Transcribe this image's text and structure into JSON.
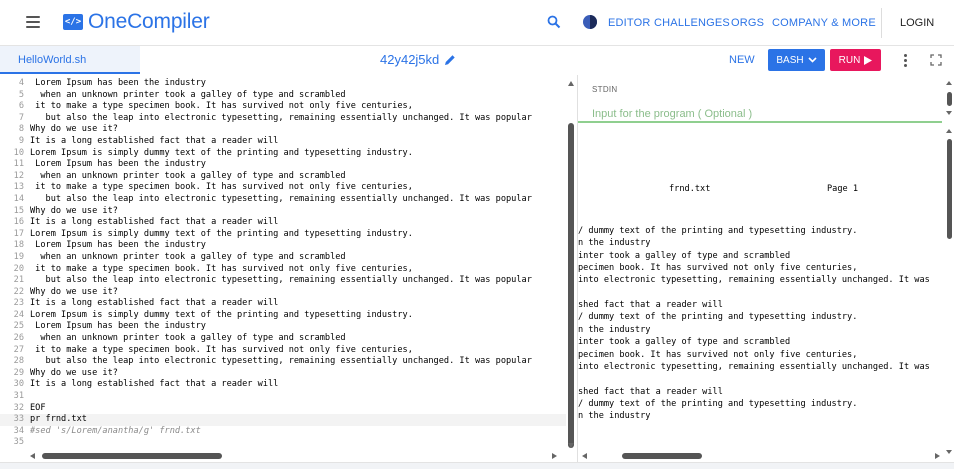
{
  "header": {
    "logo_badge": "</>",
    "logo_text": "OneCompiler",
    "nav": [
      "EDITOR",
      "CHALLENGES",
      "ORGS",
      "COMPANY & MORE"
    ],
    "login": "LOGIN"
  },
  "toolbar": {
    "file_tab": "HelloWorld.sh",
    "code_id": "42y42j5kd",
    "new_label": "NEW",
    "language_label": "BASH",
    "run_label": "RUN"
  },
  "colors": {
    "accent": "#2b73e6",
    "run": "#e8175d",
    "stdin_underline": "#8fcf8f"
  },
  "editor": {
    "lines": [
      {
        "n": "4",
        "t": " Lorem Ipsum has been the industry"
      },
      {
        "n": "5",
        "t": "  when an unknown printer took a galley of type and scrambled"
      },
      {
        "n": "6",
        "t": " it to make a type specimen book. It has survived not only five centuries,"
      },
      {
        "n": "7",
        "t": "   but also the leap into electronic typesetting, remaining essentially unchanged. It was popular"
      },
      {
        "n": "8",
        "t": "Why do we use it?"
      },
      {
        "n": "9",
        "t": "It is a long established fact that a reader will"
      },
      {
        "n": "10",
        "t": "Lorem Ipsum is simply dummy text of the printing and typesetting industry."
      },
      {
        "n": "11",
        "t": " Lorem Ipsum has been the industry"
      },
      {
        "n": "12",
        "t": "  when an unknown printer took a galley of type and scrambled"
      },
      {
        "n": "13",
        "t": " it to make a type specimen book. It has survived not only five centuries,"
      },
      {
        "n": "14",
        "t": "   but also the leap into electronic typesetting, remaining essentially unchanged. It was popular"
      },
      {
        "n": "15",
        "t": "Why do we use it?"
      },
      {
        "n": "16",
        "t": "It is a long established fact that a reader will"
      },
      {
        "n": "17",
        "t": "Lorem Ipsum is simply dummy text of the printing and typesetting industry."
      },
      {
        "n": "18",
        "t": " Lorem Ipsum has been the industry"
      },
      {
        "n": "19",
        "t": "  when an unknown printer took a galley of type and scrambled"
      },
      {
        "n": "20",
        "t": " it to make a type specimen book. It has survived not only five centuries,"
      },
      {
        "n": "21",
        "t": "   but also the leap into electronic typesetting, remaining essentially unchanged. It was popular"
      },
      {
        "n": "22",
        "t": "Why do we use it?"
      },
      {
        "n": "23",
        "t": "It is a long established fact that a reader will"
      },
      {
        "n": "24",
        "t": "Lorem Ipsum is simply dummy text of the printing and typesetting industry."
      },
      {
        "n": "25",
        "t": " Lorem Ipsum has been the industry"
      },
      {
        "n": "26",
        "t": "  when an unknown printer took a galley of type and scrambled"
      },
      {
        "n": "27",
        "t": " it to make a type specimen book. It has survived not only five centuries,"
      },
      {
        "n": "28",
        "t": "   but also the leap into electronic typesetting, remaining essentially unchanged. It was popular"
      },
      {
        "n": "29",
        "t": "Why do we use it?"
      },
      {
        "n": "30",
        "t": "It is a long established fact that a reader will"
      },
      {
        "n": "31",
        "t": ""
      },
      {
        "n": "32",
        "t": "EOF"
      },
      {
        "n": "33",
        "t": "pr frnd.txt"
      },
      {
        "n": "34",
        "t": "#sed 's/Lorem/anantha/g' frnd.txt"
      },
      {
        "n": "35",
        "t": ""
      }
    ]
  },
  "stdin": {
    "label": "STDIN",
    "placeholder": "Input for the program ( Optional )"
  },
  "output": {
    "header_file": "frnd.txt",
    "header_page": "Page 1",
    "lines": [
      "/ dummy text of the printing and typesetting industry.",
      "n the industry",
      "inter took a galley of type and scrambled",
      "pecimen book. It has survived not only five centuries,",
      "into electronic typesetting, remaining essentially unchanged. It was",
      "",
      "shed fact that a reader will",
      "/ dummy text of the printing and typesetting industry.",
      "n the industry",
      "inter took a galley of type and scrambled",
      "pecimen book. It has survived not only five centuries,",
      "into electronic typesetting, remaining essentially unchanged. It was",
      "",
      "shed fact that a reader will",
      "/ dummy text of the printing and typesetting industry.",
      "n the industry"
    ]
  }
}
